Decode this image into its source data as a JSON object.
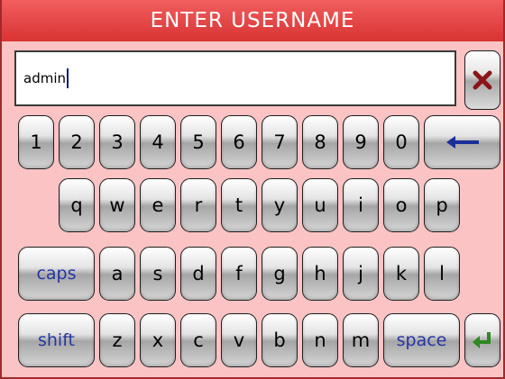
{
  "dialog": {
    "title": "ENTER USERNAME",
    "input_value": "admin"
  },
  "icons": {
    "close": "close-x-icon",
    "backspace": "left-arrow-icon",
    "enter": "enter-return-icon"
  },
  "colors": {
    "title_bar": "#e04545",
    "panel_bg": "#fbc3c3",
    "close_x": "#8b1515",
    "backspace_arrow": "#1a2e9a",
    "enter_arrow": "#2c8a1e",
    "label_text_blue": "#2535a5"
  },
  "keyboard": {
    "numbers": [
      "1",
      "2",
      "3",
      "4",
      "5",
      "6",
      "7",
      "8",
      "9",
      "0"
    ],
    "row_q": [
      "q",
      "w",
      "e",
      "r",
      "t",
      "y",
      "u",
      "i",
      "o",
      "p"
    ],
    "row_a": [
      "a",
      "s",
      "d",
      "f",
      "g",
      "h",
      "j",
      "k",
      "l"
    ],
    "row_z": [
      "z",
      "x",
      "c",
      "v",
      "b",
      "n",
      "m"
    ],
    "caps_label": "caps",
    "shift_label": "shift",
    "space_label": "space"
  }
}
